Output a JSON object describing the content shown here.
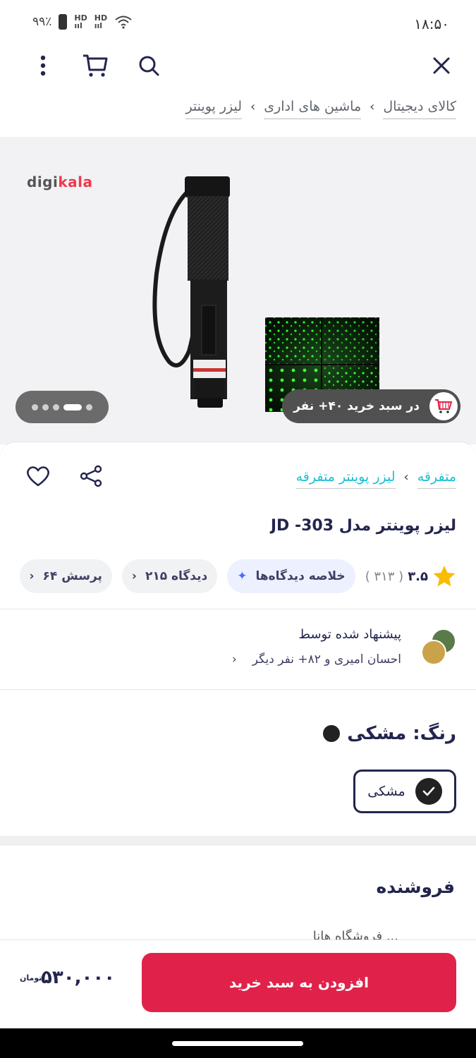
{
  "status_bar": {
    "time": "۱۸:۵۰",
    "battery": "۹۹٪",
    "signal_labels": [
      "HD",
      "HD"
    ]
  },
  "toolbar": {
    "icons": [
      "close-icon",
      "search-icon",
      "cart-icon",
      "more-vert-icon"
    ]
  },
  "breadcrumb": [
    "کالای دیجیتال",
    "ماشین های اداری",
    "لیزر پوینتر"
  ],
  "gallery": {
    "brand_pre": "digi",
    "brand_post": "kala",
    "cart_count_text": "در سبد خرید ۴۰+ نفر",
    "dots": 5,
    "active_dot": 3
  },
  "product": {
    "category_crumbs": [
      "متفرقه",
      "لیزر پوینتر متفرقه"
    ],
    "title": "لیزر پوینتر مدل JD -303",
    "rating": "۳.۵",
    "rating_count": "( ۳۱۳ )",
    "chips": {
      "summary": "خلاصه دیدگاه‌ها",
      "comments": "۲۱۵ دیدگاه",
      "questions": "۶۴ پرسش"
    },
    "recommend_title": "پیشنهاد شده توسط",
    "recommend_by": "احسان امیری و ۸۲+ نفر دیگر",
    "color_label": "رنگ: مشکی",
    "color_option": "مشکی",
    "seller_heading": "فروشنده",
    "seller_name": "فروشگاه هانا ..."
  },
  "bottom": {
    "add_to_cart": "افزودن به سبد خرید",
    "price": "۵۳۰,۰۰۰",
    "currency": "تومان"
  },
  "colors": {
    "primary": "#e0224a",
    "text": "#23254e",
    "accent": "#19bfd3",
    "laser_green": "#1fd31f"
  }
}
